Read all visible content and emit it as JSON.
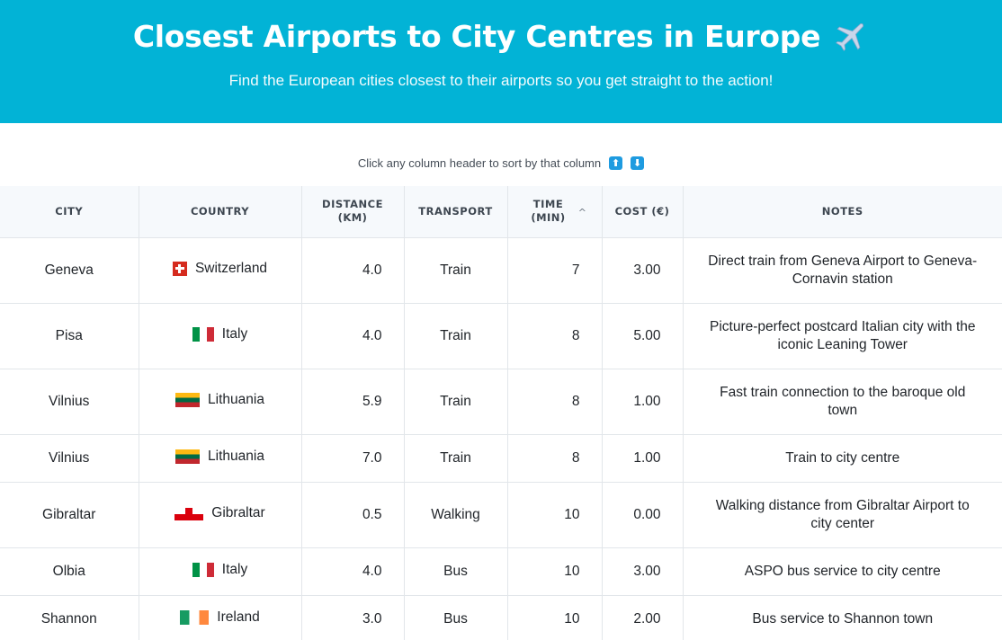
{
  "header": {
    "title": "Closest Airports to City Centres in Europe",
    "title_icon": "airplane-icon",
    "subtitle": "Find the European cities closest to their airports so you get straight to the action!"
  },
  "hint": {
    "text": "Click any column header to sort by that column",
    "up_icon": "⬆",
    "down_icon": "⬇"
  },
  "colors": {
    "brand": "#02b3d6",
    "header_bg": "#f6f9fc",
    "sort_badge": "#1e9be0"
  },
  "table": {
    "columns": [
      {
        "key": "city",
        "label": "City"
      },
      {
        "key": "country",
        "label": "Country"
      },
      {
        "key": "distance",
        "label": "Distance (km)"
      },
      {
        "key": "transport",
        "label": "Transport"
      },
      {
        "key": "time",
        "label": "Time (min)",
        "sort": "ascending",
        "sort_glyph": "^"
      },
      {
        "key": "cost",
        "label": "Cost (€)"
      },
      {
        "key": "notes",
        "label": "Notes"
      }
    ],
    "rows": [
      {
        "city": "Geneva",
        "country": "Switzerland",
        "flag": "ch",
        "distance": "4.0",
        "transport": "Train",
        "time": "7",
        "cost": "3.00",
        "notes": "Direct train from Geneva Airport to Geneva-Cornavin station"
      },
      {
        "city": "Pisa",
        "country": "Italy",
        "flag": "it",
        "distance": "4.0",
        "transport": "Train",
        "time": "8",
        "cost": "5.00",
        "notes": "Picture-perfect postcard Italian city with the iconic Leaning Tower"
      },
      {
        "city": "Vilnius",
        "country": "Lithuania",
        "flag": "lt",
        "distance": "5.9",
        "transport": "Train",
        "time": "8",
        "cost": "1.00",
        "notes": "Fast train connection to the baroque old town"
      },
      {
        "city": "Vilnius",
        "country": "Lithuania",
        "flag": "lt",
        "distance": "7.0",
        "transport": "Train",
        "time": "8",
        "cost": "1.00",
        "notes": "Train to city centre"
      },
      {
        "city": "Gibraltar",
        "country": "Gibraltar",
        "flag": "gi",
        "distance": "0.5",
        "transport": "Walking",
        "time": "10",
        "cost": "0.00",
        "notes": "Walking distance from Gibraltar Airport to city center"
      },
      {
        "city": "Olbia",
        "country": "Italy",
        "flag": "it",
        "distance": "4.0",
        "transport": "Bus",
        "time": "10",
        "cost": "3.00",
        "notes": "ASPO bus service to city centre"
      },
      {
        "city": "Shannon",
        "country": "Ireland",
        "flag": "ie",
        "distance": "3.0",
        "transport": "Bus",
        "time": "10",
        "cost": "2.00",
        "notes": "Bus service to Shannon town"
      }
    ]
  }
}
